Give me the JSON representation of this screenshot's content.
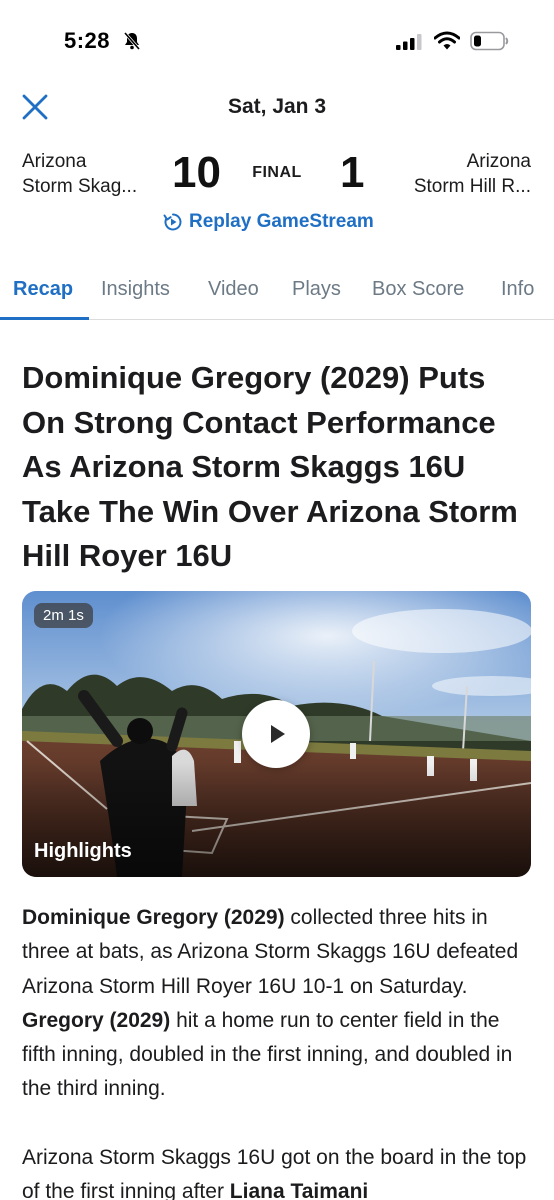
{
  "status_bar": {
    "time": "5:28",
    "icons": [
      "bell-slash-icon",
      "signal-icon",
      "wifi-icon",
      "battery-icon"
    ]
  },
  "header": {
    "date": "Sat, Jan 3",
    "close_icon": "close-icon"
  },
  "scoreboard": {
    "home_team_line1": "Arizona",
    "home_team_line2": "Storm Skag...",
    "home_score": "10",
    "status": "FINAL",
    "away_score": "1",
    "away_team_line1": "Arizona",
    "away_team_line2": "Storm Hill R...",
    "replay_label": "Replay GameStream"
  },
  "tabs": [
    {
      "label": "Recap",
      "active": true
    },
    {
      "label": "Insights",
      "active": false
    },
    {
      "label": "Video",
      "active": false
    },
    {
      "label": "Plays",
      "active": false
    },
    {
      "label": "Box Score",
      "active": false
    },
    {
      "label": "Info",
      "active": false
    }
  ],
  "article": {
    "headline": "Dominique Gregory (2029) Puts On Strong Contact Performance As Arizona Storm Skaggs 16U Take The Win Over Arizona Storm Hill Royer 16U",
    "video": {
      "duration": "2m 1s",
      "label": "Highlights"
    },
    "paragraph1": {
      "bold1": "Dominique Gregory (2029)",
      "text1": " collected three hits in three at bats, as Arizona Storm Skaggs 16U defeated Arizona Storm Hill Royer 16U 10-1 on Saturday. ",
      "bold2": "Gregory (2029)",
      "text2": " hit a home run to center field in the fifth inning, doubled in the first inning, and doubled in the third inning."
    },
    "paragraph2": {
      "text1": "Arizona Storm Skaggs 16U got on the board in the top of the first inning after ",
      "bold1": "Liana Taimani"
    }
  },
  "colors": {
    "accent": "#1f6fc4",
    "tab_inactive": "#6c7a86",
    "text": "#1c1c1e"
  }
}
